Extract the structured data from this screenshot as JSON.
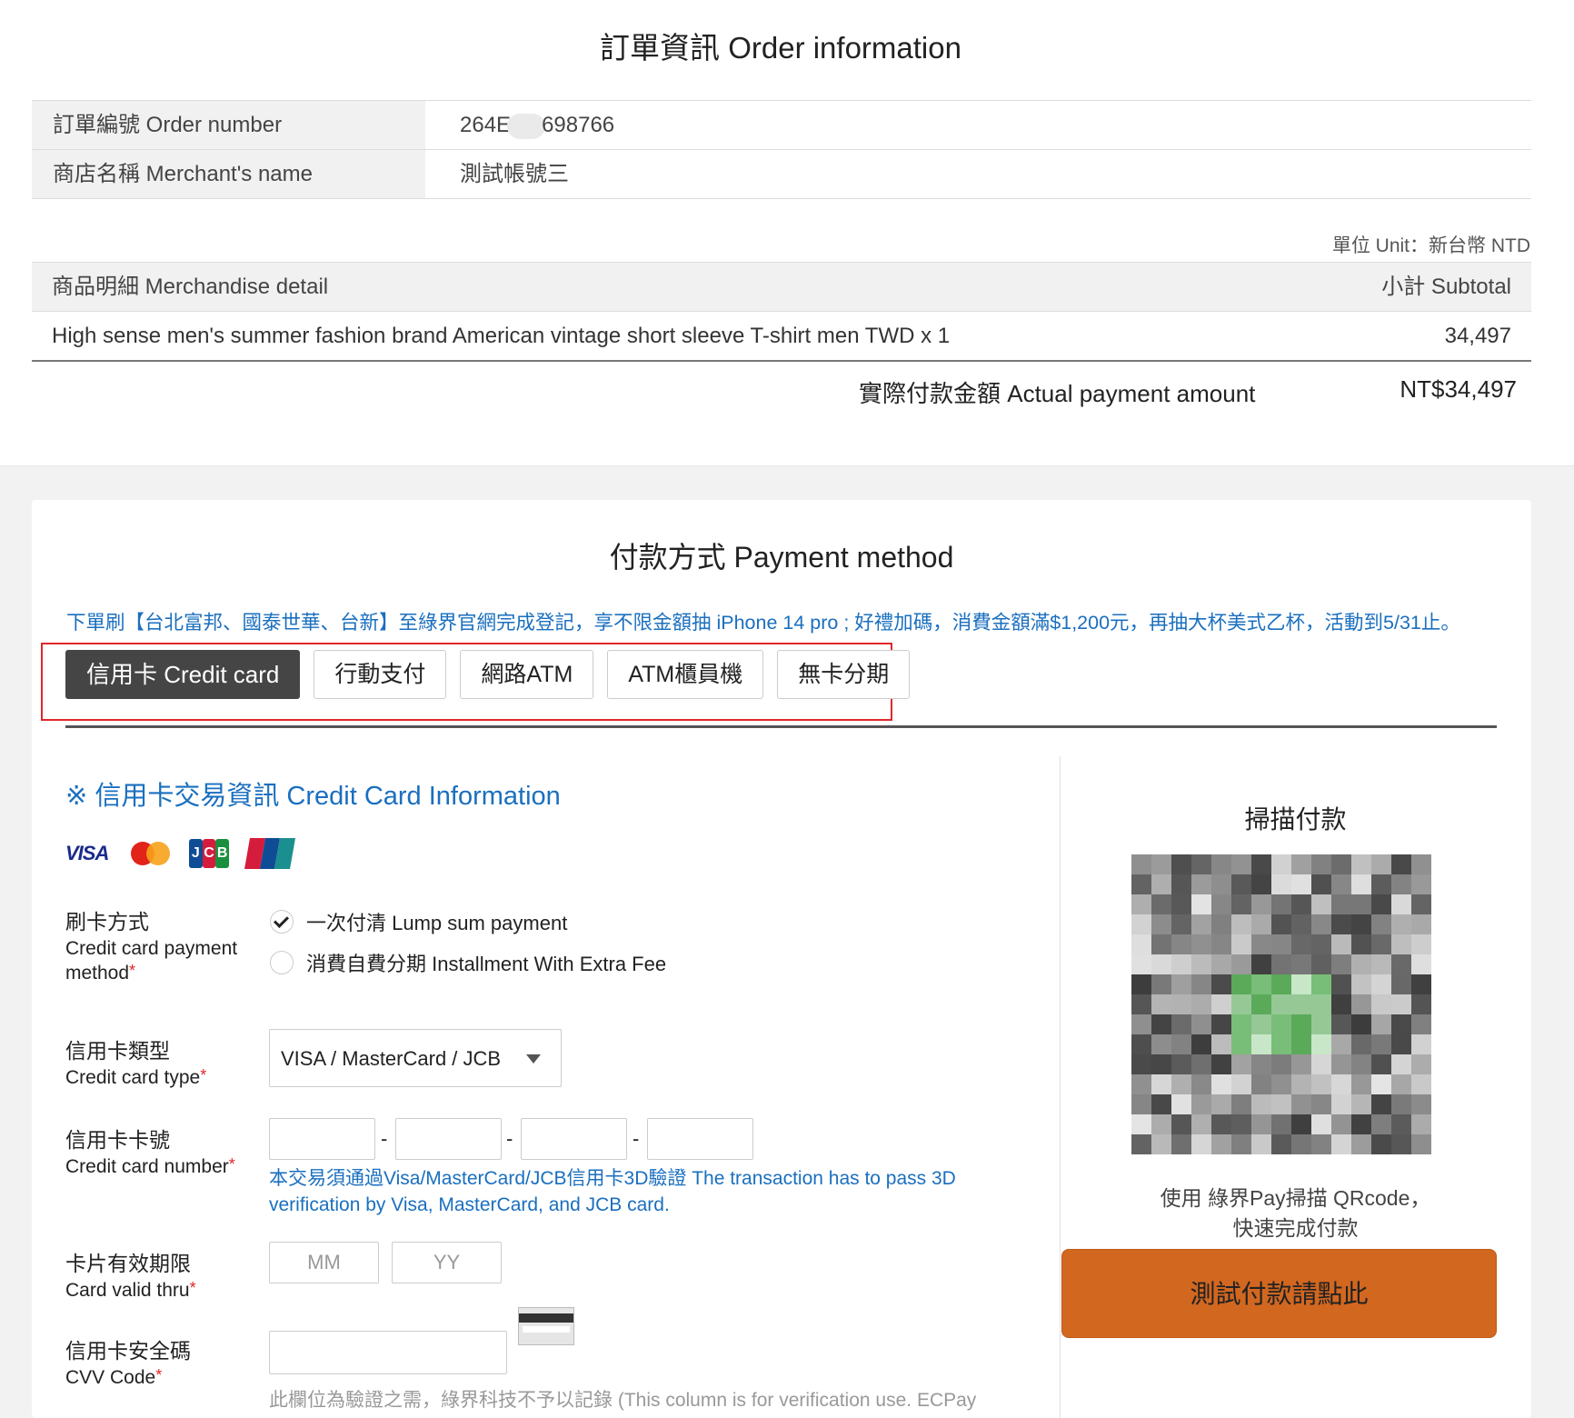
{
  "order": {
    "title": "訂單資訊 Order information",
    "rows": [
      {
        "label": "訂單編號 Order number",
        "value_prefix": "264E",
        "value_suffix": "698766"
      },
      {
        "label": "商店名稱 Merchant's name",
        "value": "測試帳號三"
      }
    ],
    "unit": "單位 Unit：新台幣 NTD",
    "merch_header": {
      "detail": "商品明細 Merchandise detail",
      "subtotal": "小計 Subtotal"
    },
    "merch_item": {
      "name": "High sense men's summer fashion brand American vintage short sleeve T-shirt men TWD x 1",
      "subtotal": "34,497"
    },
    "total_label": "實際付款金額 Actual payment amount",
    "total_value": "NT$34,497"
  },
  "payment": {
    "title": "付款方式 Payment method",
    "promo": "下單刷【台北富邦、國泰世華、台新】至綠界官網完成登記，享不限金額抽 iPhone 14 pro ; 好禮加碼，消費金額滿$1,200元，再抽大杯美式乙杯，活動到5/31止。",
    "tabs": [
      "信用卡 Credit card",
      "行動支付",
      "網路ATM",
      "ATM櫃員機",
      "無卡分期"
    ],
    "active_tab": 0
  },
  "credit": {
    "title": "※ 信用卡交易資訊 Credit Card Information",
    "logos": {
      "visa": "VISA",
      "mastercard": "MasterCard",
      "jcb": [
        "J",
        "C",
        "B"
      ],
      "unionpay": "UnionPay 銀聯"
    },
    "method_label_zh": "刷卡方式",
    "method_label_en": "Credit card payment method",
    "method_options": [
      "一次付清 Lump sum payment",
      "消費自費分期 Installment With Extra Fee"
    ],
    "method_selected": 0,
    "type_label_zh": "信用卡類型",
    "type_label_en": "Credit card type",
    "type_value": "VISA / MasterCard / JCB",
    "number_label_zh": "信用卡卡號",
    "number_label_en": "Credit card number",
    "number_note": "本交易須通過Visa/MasterCard/JCB信用卡3D驗證 The transaction has to pass 3D verification by Visa, MasterCard, and JCB card.",
    "valid_label_zh": "卡片有效期限",
    "valid_label_en": "Card valid thru",
    "mm_placeholder": "MM",
    "yy_placeholder": "YY",
    "cvv_label_zh": "信用卡安全碼",
    "cvv_label_en": "CVV Code",
    "cvv_note": "此欄位為驗證之需，綠界科技不予以記錄 (This column is for verification use. ECPay",
    "required_mark": "*",
    "dash": "-"
  },
  "scan": {
    "title": "掃描付款",
    "desc_line1": "使用 綠界Pay掃描 QRcode，",
    "desc_line2": "快速完成付款",
    "button": "測試付款請點此"
  },
  "colors": {
    "accent_blue": "#1a6fbf",
    "button_orange": "#d26720",
    "required_red": "#e0272b",
    "active_tab": "#454545"
  }
}
